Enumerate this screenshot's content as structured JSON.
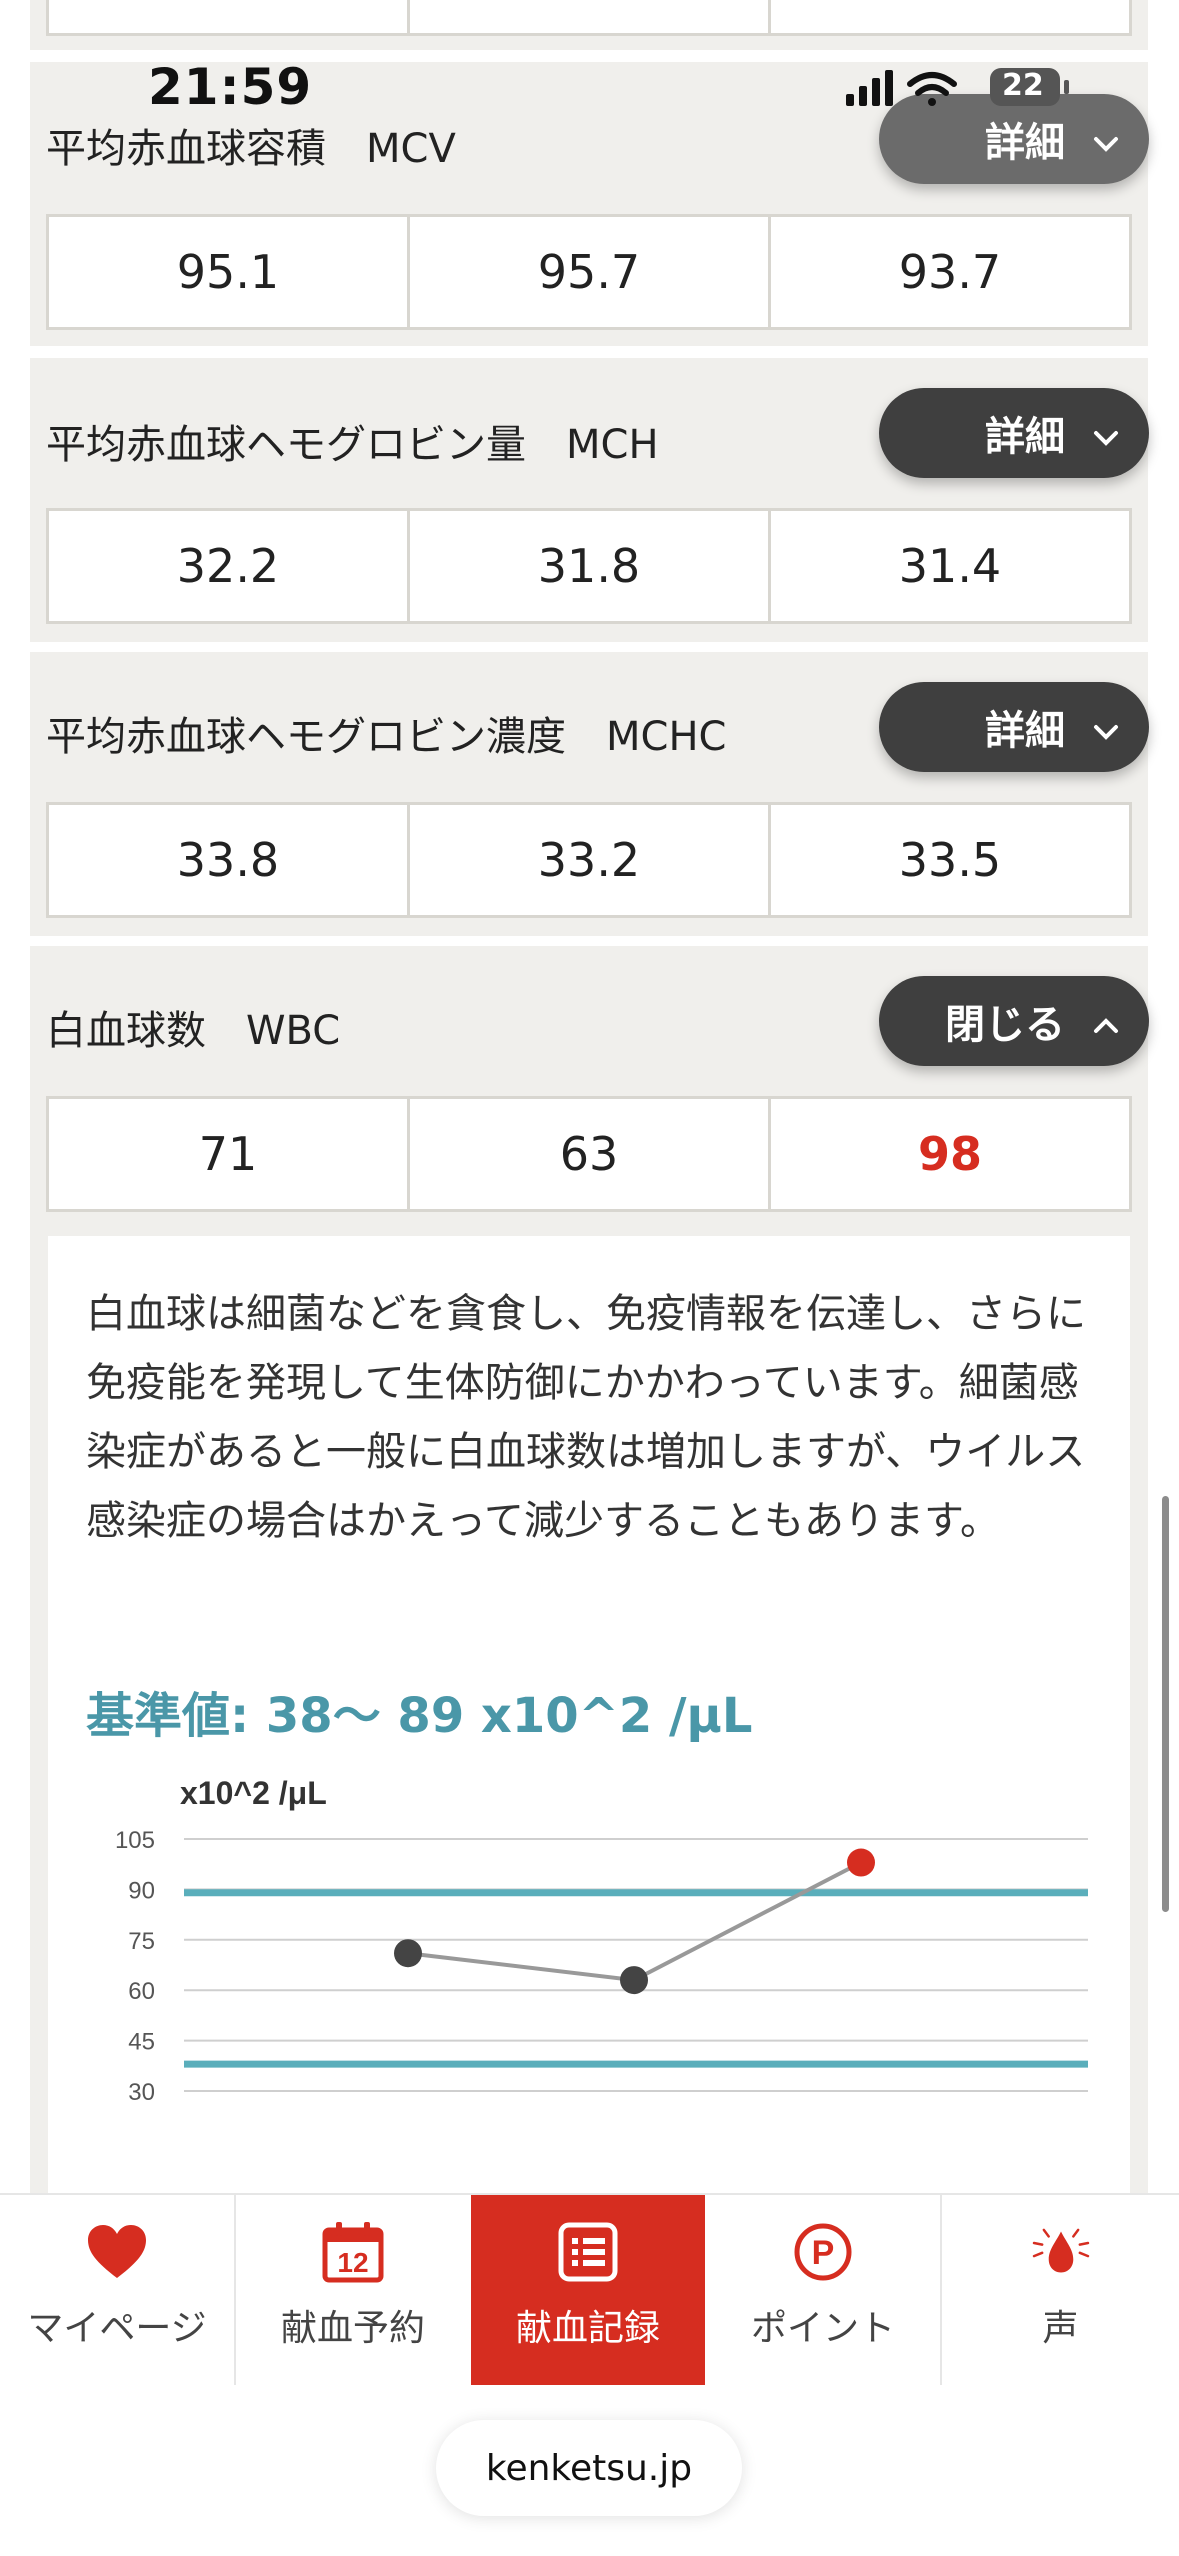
{
  "status": {
    "time": "21:59",
    "battery": "22"
  },
  "sections": [
    {
      "title": "平均赤血球容積　MCV",
      "button": "詳細",
      "values": [
        "95.1",
        "95.7",
        "93.7"
      ]
    },
    {
      "title": "平均赤血球ヘモグロビン量　MCH",
      "button": "詳細",
      "values": [
        "32.2",
        "31.8",
        "31.4"
      ]
    },
    {
      "title": "平均赤血球ヘモグロビン濃度　MCHC",
      "button": "詳細",
      "values": [
        "33.8",
        "33.2",
        "33.5"
      ]
    },
    {
      "title": "白血球数　WBC",
      "button": "閉じる",
      "values": [
        "71",
        "63",
        "98"
      ]
    }
  ],
  "wbc_detail": {
    "description": "白血球は細菌などを貪食し、免疫情報を伝達し、さらに免疫能を発現して生体防御にかかわっています。細菌感染症があると一般に白血球数は増加しますが、ウイルス感染症の場合はかえって減少することもあります。",
    "reference": "基準値: 38〜 89 x10^2 /μL"
  },
  "chart_data": {
    "type": "line",
    "ylabel": "x10^2 /μL",
    "y_ticks": [
      "105",
      "90",
      "75",
      "60",
      "45",
      "30"
    ],
    "ylim": [
      30,
      105
    ],
    "reference_lines": [
      89,
      38
    ],
    "series": [
      {
        "values": [
          71,
          63,
          98
        ]
      }
    ],
    "high_point_color": "#d62d20",
    "normal_point_color": "#444444",
    "reference_line_color": "#5aaebb",
    "grid": true
  },
  "nav": [
    {
      "label": "マイページ",
      "icon": "heart-icon"
    },
    {
      "label": "献血予約",
      "icon": "calendar-icon",
      "calendar_day": "12"
    },
    {
      "label": "献血記録",
      "icon": "record-list-icon",
      "active": true
    },
    {
      "label": "ポイント",
      "icon": "point-icon",
      "point_letter": "P"
    },
    {
      "label": "声",
      "icon": "blood-drop-voice-icon"
    }
  ],
  "browser": {
    "url": "kenketsu.jp"
  },
  "colors": {
    "accent": "#d62d20",
    "teal": "#4a97a8",
    "panel": "#f0efec"
  }
}
